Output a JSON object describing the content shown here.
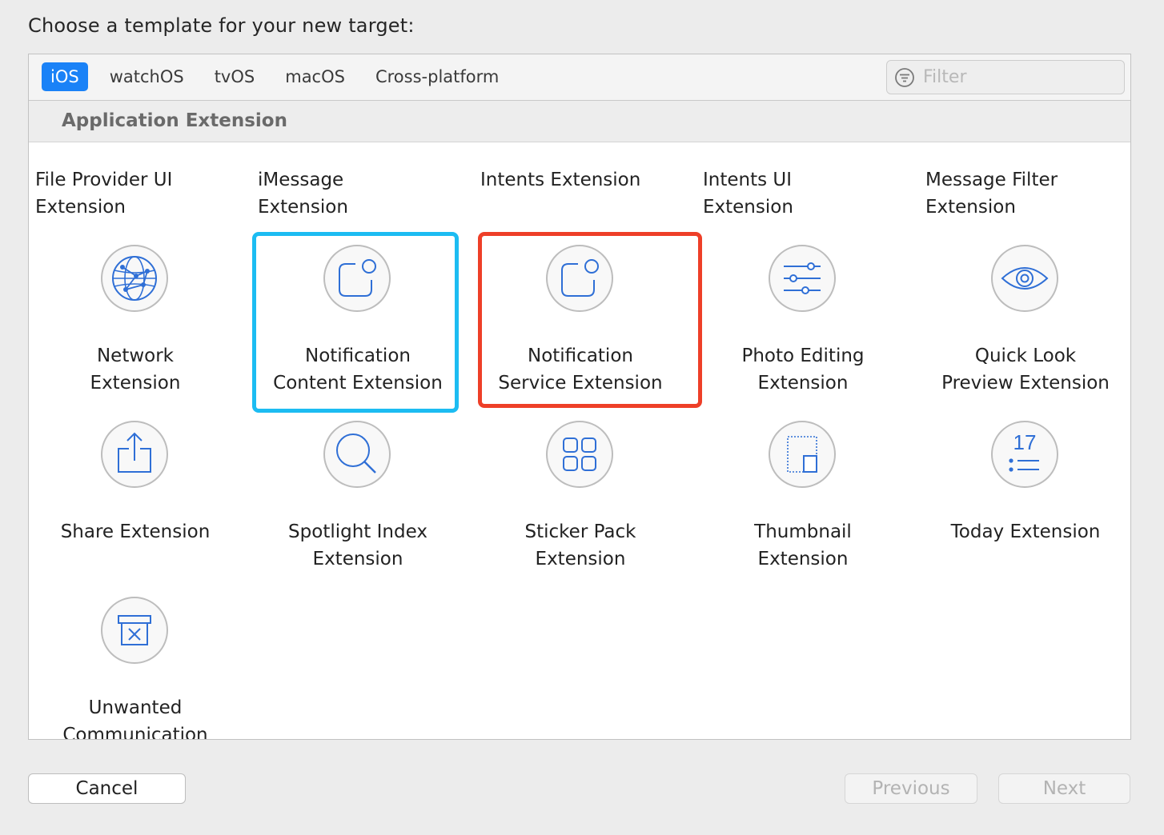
{
  "prompt": "Choose a template for your new target:",
  "tabs": [
    {
      "label": "iOS",
      "active": true
    },
    {
      "label": "watchOS",
      "active": false
    },
    {
      "label": "tvOS",
      "active": false
    },
    {
      "label": "macOS",
      "active": false
    },
    {
      "label": "Cross-platform",
      "active": false
    }
  ],
  "filter": {
    "placeholder": "Filter",
    "value": "",
    "icon": "filter-icon"
  },
  "section": {
    "title": "Application Extension"
  },
  "top_row_labels": [
    [
      "File Provider UI",
      "Extension"
    ],
    [
      "iMessage",
      "Extension"
    ],
    [
      "Intents Extension"
    ],
    [
      "Intents UI",
      "Extension"
    ],
    [
      "Message Filter",
      "Extension"
    ]
  ],
  "templates": [
    {
      "label": [
        "Network",
        "Extension"
      ],
      "icon": "network-globe-icon"
    },
    {
      "label": [
        "Notification",
        "Content Extension"
      ],
      "icon": "notification-badge-icon",
      "highlight": "blue"
    },
    {
      "label": [
        "Notification",
        "Service Extension"
      ],
      "icon": "notification-badge-icon",
      "highlight": "red"
    },
    {
      "label": [
        "Photo Editing",
        "Extension"
      ],
      "icon": "sliders-icon"
    },
    {
      "label": [
        "Quick Look",
        "Preview Extension"
      ],
      "icon": "eye-icon"
    },
    {
      "label": [
        "Share Extension"
      ],
      "icon": "share-icon"
    },
    {
      "label": [
        "Spotlight Index",
        "Extension"
      ],
      "icon": "magnifier-icon"
    },
    {
      "label": [
        "Sticker Pack",
        "Extension"
      ],
      "icon": "sticker-grid-icon"
    },
    {
      "label": [
        "Thumbnail",
        "Extension"
      ],
      "icon": "thumbnail-icon"
    },
    {
      "label": [
        "Today Extension"
      ],
      "icon": "calendar-list-icon",
      "icon_text": "17"
    },
    {
      "label": [
        "Unwanted",
        "Communication"
      ],
      "icon": "junk-box-icon"
    }
  ],
  "buttons": {
    "cancel": "Cancel",
    "previous": "Previous",
    "next": "Next"
  },
  "colors": {
    "accent": "#1a82f7",
    "icon_stroke": "#2f6fd6",
    "highlight_blue": "#1cbcf2",
    "highlight_red": "#ee3f28"
  }
}
